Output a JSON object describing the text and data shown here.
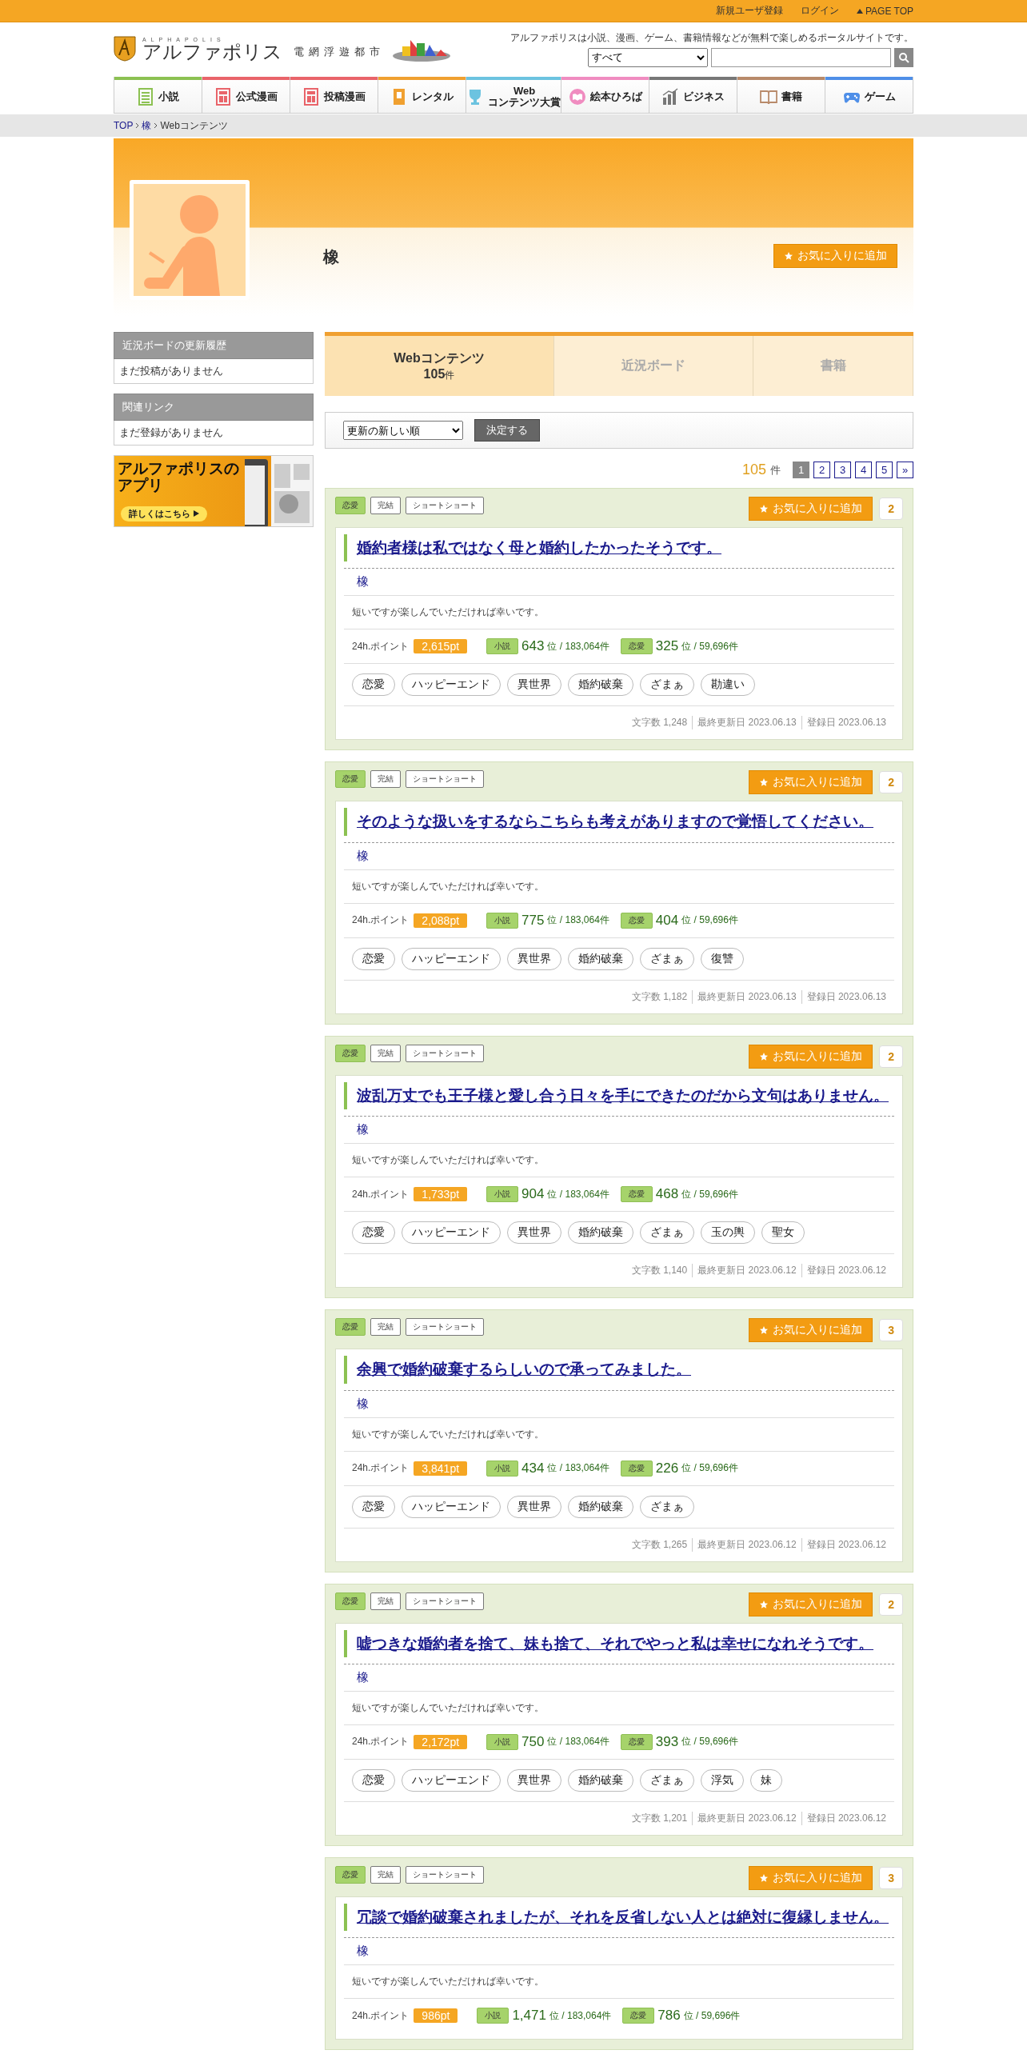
{
  "top_bar": {
    "links": [
      "新規ユーザ登録",
      "ログイン"
    ],
    "page_top": "PAGE TOP"
  },
  "header": {
    "logo": {
      "latin": "ALPHAPOLIS",
      "name": "アルファポリス",
      "subtitle": "電網浮遊都市"
    },
    "tagline": "アルファポリスは小説、漫画、ゲーム、書籍情報などが無料で楽しめるポータルサイトです。",
    "search": {
      "category": "すべて"
    }
  },
  "nav": [
    {
      "label": "小説",
      "kind": "doc",
      "color": "#8cc152"
    },
    {
      "label": "公式漫画",
      "kind": "manga",
      "color": "#e9646a"
    },
    {
      "label": "投稿漫画",
      "kind": "manga",
      "color": "#e9646a"
    },
    {
      "label": "レンタル",
      "kind": "rental",
      "color": "#f0a030"
    },
    {
      "label": "Web\nコンテンツ大賞",
      "kind": "trophy",
      "color": "#6cc3e0"
    },
    {
      "label": "絵本ひろば",
      "kind": "picturebook",
      "color": "#f08cc0"
    },
    {
      "label": "ビジネス",
      "kind": "chart",
      "color": "#777777"
    },
    {
      "label": "書籍",
      "kind": "book",
      "color": "#b88a6a"
    },
    {
      "label": "ゲーム",
      "kind": "gamepad",
      "color": "#4f8fe8"
    }
  ],
  "breadcrumb": [
    "TOP",
    "橡",
    "Webコンテンツ"
  ],
  "profile": {
    "name": "橡",
    "favorite_button": "お気に入りに追加"
  },
  "sidebar": {
    "boxes": [
      {
        "title": "近況ボードの更新履歴",
        "body": "まだ投稿がありません"
      },
      {
        "title": "関連リンク",
        "body": "まだ登録がありません"
      }
    ],
    "banner": {
      "title": "アルファポリスのアプリ",
      "button": "詳しくはこちら"
    }
  },
  "tabs": [
    {
      "label": "Webコンテンツ",
      "count": "105",
      "unit": "件",
      "selected": true
    },
    {
      "label": "近況ボード",
      "selected": false
    },
    {
      "label": "書籍",
      "selected": false
    }
  ],
  "sort": {
    "value": "更新の新しい順",
    "button": "決定する"
  },
  "pagination": {
    "total": "105",
    "unit": "件",
    "pages": [
      {
        "label": "1",
        "selected": true
      },
      {
        "label": "2",
        "selected": false
      },
      {
        "label": "3",
        "selected": false
      },
      {
        "label": "4",
        "selected": false
      },
      {
        "label": "5",
        "selected": false
      }
    ],
    "next": "»"
  },
  "works": [
    {
      "labels": [
        {
          "text": "恋愛",
          "kind": "genre"
        },
        {
          "text": "完結",
          "kind": "status"
        },
        {
          "text": "ショートショート",
          "kind": "length"
        }
      ],
      "favorite_button": "お気に入りに追加",
      "favorite_count": "2",
      "title": "婚約者様は私ではなく母と婚約したかったそうです。",
      "author": "橡",
      "description": "短いですが楽しんでいただければ幸いです。",
      "points_label": "24h.ポイント",
      "points": "2,615pt",
      "ranks": [
        {
          "label": "小説",
          "rank": "643",
          "suffix": "位 / 183,064件"
        },
        {
          "label": "恋愛",
          "rank": "325",
          "suffix": "位 / 59,696件"
        }
      ],
      "tags": [
        "恋愛",
        "ハッピーエンド",
        "異世界",
        "婚約破棄",
        "ざまぁ",
        "勘違い"
      ],
      "footer": [
        "文字数 1,248",
        "最終更新日 2023.06.13",
        "登録日 2023.06.13"
      ]
    },
    {
      "labels": [
        {
          "text": "恋愛",
          "kind": "genre"
        },
        {
          "text": "完結",
          "kind": "status"
        },
        {
          "text": "ショートショート",
          "kind": "length"
        }
      ],
      "favorite_button": "お気に入りに追加",
      "favorite_count": "2",
      "title": "そのような扱いをするならこちらも考えがありますので覚悟してください。",
      "author": "橡",
      "description": "短いですが楽しんでいただければ幸いです。",
      "points_label": "24h.ポイント",
      "points": "2,088pt",
      "ranks": [
        {
          "label": "小説",
          "rank": "775",
          "suffix": "位 / 183,064件"
        },
        {
          "label": "恋愛",
          "rank": "404",
          "suffix": "位 / 59,696件"
        }
      ],
      "tags": [
        "恋愛",
        "ハッピーエンド",
        "異世界",
        "婚約破棄",
        "ざまぁ",
        "復讐"
      ],
      "footer": [
        "文字数 1,182",
        "最終更新日 2023.06.13",
        "登録日 2023.06.13"
      ]
    },
    {
      "labels": [
        {
          "text": "恋愛",
          "kind": "genre"
        },
        {
          "text": "完結",
          "kind": "status"
        },
        {
          "text": "ショートショート",
          "kind": "length"
        }
      ],
      "favorite_button": "お気に入りに追加",
      "favorite_count": "2",
      "title": "波乱万丈でも王子様と愛し合う日々を手にできたのだから文句はありません。",
      "author": "橡",
      "description": "短いですが楽しんでいただければ幸いです。",
      "points_label": "24h.ポイント",
      "points": "1,733pt",
      "ranks": [
        {
          "label": "小説",
          "rank": "904",
          "suffix": "位 / 183,064件"
        },
        {
          "label": "恋愛",
          "rank": "468",
          "suffix": "位 / 59,696件"
        }
      ],
      "tags": [
        "恋愛",
        "ハッピーエンド",
        "異世界",
        "婚約破棄",
        "ざまぁ",
        "玉の輿",
        "聖女"
      ],
      "footer": [
        "文字数 1,140",
        "最終更新日 2023.06.12",
        "登録日 2023.06.12"
      ]
    },
    {
      "labels": [
        {
          "text": "恋愛",
          "kind": "genre"
        },
        {
          "text": "完結",
          "kind": "status"
        },
        {
          "text": "ショートショート",
          "kind": "length"
        }
      ],
      "favorite_button": "お気に入りに追加",
      "favorite_count": "3",
      "title": "余興で婚約破棄するらしいので承ってみました。",
      "author": "橡",
      "description": "短いですが楽しんでいただければ幸いです。",
      "points_label": "24h.ポイント",
      "points": "3,841pt",
      "ranks": [
        {
          "label": "小説",
          "rank": "434",
          "suffix": "位 / 183,064件"
        },
        {
          "label": "恋愛",
          "rank": "226",
          "suffix": "位 / 59,696件"
        }
      ],
      "tags": [
        "恋愛",
        "ハッピーエンド",
        "異世界",
        "婚約破棄",
        "ざまぁ"
      ],
      "footer": [
        "文字数 1,265",
        "最終更新日 2023.06.12",
        "登録日 2023.06.12"
      ]
    },
    {
      "labels": [
        {
          "text": "恋愛",
          "kind": "genre"
        },
        {
          "text": "完結",
          "kind": "status"
        },
        {
          "text": "ショートショート",
          "kind": "length"
        }
      ],
      "favorite_button": "お気に入りに追加",
      "favorite_count": "2",
      "title": "嘘つきな婚約者を捨て、妹も捨て、それでやっと私は幸せになれそうです。",
      "author": "橡",
      "description": "短いですが楽しんでいただければ幸いです。",
      "points_label": "24h.ポイント",
      "points": "2,172pt",
      "ranks": [
        {
          "label": "小説",
          "rank": "750",
          "suffix": "位 / 183,064件"
        },
        {
          "label": "恋愛",
          "rank": "393",
          "suffix": "位 / 59,696件"
        }
      ],
      "tags": [
        "恋愛",
        "ハッピーエンド",
        "異世界",
        "婚約破棄",
        "ざまぁ",
        "浮気",
        "妹"
      ],
      "footer": [
        "文字数 1,201",
        "最終更新日 2023.06.12",
        "登録日 2023.06.12"
      ]
    },
    {
      "labels": [
        {
          "text": "恋愛",
          "kind": "genre"
        },
        {
          "text": "完結",
          "kind": "status"
        },
        {
          "text": "ショートショート",
          "kind": "length"
        }
      ],
      "favorite_button": "お気に入りに追加",
      "favorite_count": "3",
      "title": "冗談で婚約破棄されましたが、それを反省しない人とは絶対に復縁しません。",
      "author": "橡",
      "description": "短いですが楽しんでいただければ幸いです。",
      "points_label": "24h.ポイント",
      "points": "986pt",
      "ranks": [
        {
          "label": "小説",
          "rank": "1,471",
          "suffix": "位 / 183,064件"
        },
        {
          "label": "恋愛",
          "rank": "786",
          "suffix": "位 / 59,696件"
        }
      ]
    }
  ]
}
